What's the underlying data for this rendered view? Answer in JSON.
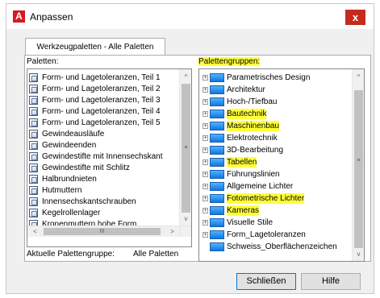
{
  "window": {
    "title": "Anpassen",
    "app_icon": "A",
    "close_glyph": "x"
  },
  "tab": {
    "label": "Werkzeugpaletten - Alle Paletten"
  },
  "paletten": {
    "label": "Paletten:",
    "items": [
      "Form- und Lagetoleranzen, Teil 1",
      "Form- und Lagetoleranzen, Teil 2",
      "Form- und Lagetoleranzen, Teil 3",
      "Form- und Lagetoleranzen, Teil 4",
      "Form- und Lagetoleranzen, Teil 5",
      "Gewindeausläufe",
      "Gewindeenden",
      "Gewindestifte mit Innensechskant",
      "Gewindestifte mit Schlitz",
      "Halbrundnieten",
      "Hutmuttern",
      "Innensechskantschrauben",
      "Kegelrollenlager",
      "Kronenmuttern hohe Form"
    ]
  },
  "palettengruppen": {
    "label": "Palettengruppen:",
    "items": [
      {
        "label": "Parametrisches Design",
        "highlight": false
      },
      {
        "label": "Architektur",
        "highlight": false
      },
      {
        "label": "Hoch-/Tiefbau",
        "highlight": false
      },
      {
        "label": "Bautechnik",
        "highlight": true
      },
      {
        "label": "Maschinenbau",
        "highlight": true
      },
      {
        "label": "Elektrotechnik",
        "highlight": false
      },
      {
        "label": "3D-Bearbeitung",
        "highlight": false
      },
      {
        "label": "Tabellen",
        "highlight": true
      },
      {
        "label": "Führungslinien",
        "highlight": false
      },
      {
        "label": "Allgemeine Lichter",
        "highlight": false
      },
      {
        "label": "Fotometrische Lichter",
        "highlight": true
      },
      {
        "label": "Kameras",
        "highlight": true
      },
      {
        "label": "Visuelle Stile",
        "highlight": false
      },
      {
        "label": "Form_Lagetoleranzen",
        "highlight": false
      },
      {
        "label": "Schweiss_Oberflächenzeichen",
        "highlight": false
      }
    ]
  },
  "scroll": {
    "up": "^",
    "down": "v",
    "left": "<",
    "right": ">",
    "grip_v": "≡",
    "grip_h": "III"
  },
  "status": {
    "label": "Aktuelle Palettengruppe:",
    "value": "Alle Paletten"
  },
  "buttons": {
    "close": "Schließen",
    "help": "Hilfe"
  },
  "colors": {
    "highlight": "#ffff3a",
    "close_button": "#c42b1c",
    "app_icon": "#d71920"
  }
}
